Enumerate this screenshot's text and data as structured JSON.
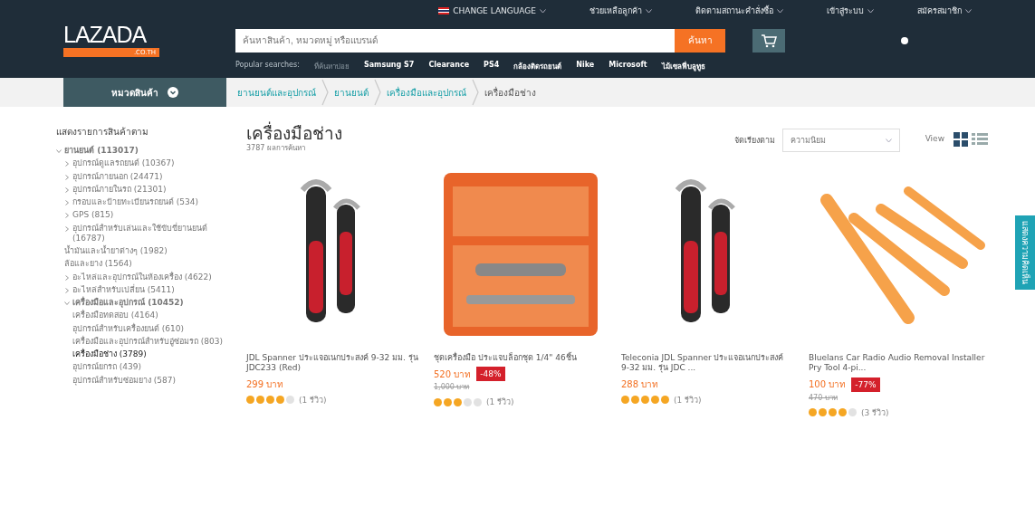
{
  "top_bar": {
    "language": "CHANGE LANGUAGE",
    "links": [
      "ช่วยเหลือลูกค้า",
      "ติดตามสถานะคำสั่งซื้อ",
      "เข้าสู่ระบบ",
      "สมัครสมาชิก"
    ]
  },
  "header": {
    "logo": "LAZADA",
    "logo_domain": ".CO.TH",
    "search": {
      "placeholder": "ค้นหาสินค้า, หมวดหมู่ หรือแบรนด์",
      "button": "ค้นหา"
    },
    "popular_label": "Popular searches:",
    "popular": [
      "ที่ค้นหาบ่อย",
      "Samsung S7",
      "Clearance",
      "PS4",
      "กล้องติดรถยนต์",
      "Nike",
      "Microsoft",
      "ไม้เซลฟี่บลูทูธ"
    ]
  },
  "category_button": "หมวดสินค้า",
  "breadcrumbs": [
    {
      "label": "ยานยนต์และอุปกรณ์",
      "current": false
    },
    {
      "label": "ยานยนต์",
      "current": false
    },
    {
      "label": "เครื่องมือและอุปกรณ์",
      "current": false
    },
    {
      "label": "เครื่องมือช่าง",
      "current": true
    }
  ],
  "sidebar": {
    "title": "แสดงรายการสินค้าตาม",
    "tree": [
      {
        "label": "ยานยนต์ (113017)",
        "expanded": true,
        "selected": false,
        "children": [
          {
            "label": "อุปกรณ์ดูแลรถยนต์ (10367)",
            "expanded": false,
            "selected": false
          },
          {
            "label": "อุปกรณ์ภายนอก (24471)",
            "expanded": false,
            "selected": false
          },
          {
            "label": "อุปกรณ์ภายในรถ (21301)",
            "expanded": false,
            "selected": false
          },
          {
            "label": "กรอบและป้ายทะเบียนรถยนต์ (534)",
            "expanded": false,
            "selected": false
          },
          {
            "label": "GPS (815)",
            "expanded": false,
            "selected": false
          },
          {
            "label": "อุปกรณ์สำหรับเล่นและใช้ขับขี่ยานยนต์ (16787)",
            "expanded": false,
            "selected": false
          },
          {
            "label": "น้ำมันและน้ำยาต่างๆ (1982)",
            "expanded": false,
            "selected": false,
            "leaf": true
          },
          {
            "label": "ล้อและยาง (1564)",
            "expanded": false,
            "selected": false,
            "leaf": true
          },
          {
            "label": "อะไหล่และอุปกรณ์ในห้องเครื่อง (4622)",
            "expanded": false,
            "selected": false
          },
          {
            "label": "อะไหล่สำหรับเปลี่ยน (5411)",
            "expanded": false,
            "selected": false
          },
          {
            "label": "เครื่องมือและอุปกรณ์ (10452)",
            "expanded": true,
            "selected": false,
            "children": [
              {
                "label": "เครื่องมือทดสอบ (4164)",
                "expanded": false,
                "selected": false,
                "leaf": true
              },
              {
                "label": "อุปกรณ์สำหรับเครื่องยนต์ (610)",
                "expanded": false,
                "selected": false,
                "leaf": true
              },
              {
                "label": "เครื่องมือและอุปกรณ์สำหรับอู่ซ่อมรถ (803)",
                "expanded": false,
                "selected": false,
                "leaf": true
              },
              {
                "label": "เครื่องมือช่าง (3789)",
                "expanded": false,
                "selected": true,
                "leaf": true
              },
              {
                "label": "อุปกรณ์ยกรถ (439)",
                "expanded": false,
                "selected": false,
                "leaf": true
              },
              {
                "label": "อุปกรณ์สำหรับซ่อมยาง (587)",
                "expanded": false,
                "selected": false,
                "leaf": true
              }
            ]
          }
        ]
      }
    ]
  },
  "listing": {
    "title": "เครื่องมือช่าง",
    "count": "3787 ผลการค้นหา",
    "sort_label": "จัดเรียงตาม",
    "sort_value": "ความนิยม",
    "view_label": "View",
    "views": [
      {
        "kind": "grid",
        "selected": true
      },
      {
        "kind": "list",
        "selected": false
      }
    ]
  },
  "products": [
    {
      "kind": "wrench",
      "name": "JDL Spanner ประแจอเนกประสงค์ 9-32 มม. รุ่น JDC233 (Red)",
      "price": "299 บาท",
      "stars": 4,
      "reviews": "(1 รีวิว)"
    },
    {
      "kind": "socket-set",
      "name": "ชุดเครื่องมือ ประแจบล็อกชุด 1/4\" 46ชิ้น",
      "price": "520 บาท",
      "discount": "-48%",
      "old_price": "1,000 บาท",
      "stars": 3,
      "reviews": "(1 รีวิว)"
    },
    {
      "kind": "wrench",
      "name": "Teleconia JDL Spanner ประแจอเนกประสงค์ 9-32 มม. รุ่น JDC ...",
      "price": "288 บาท",
      "stars": 5,
      "reviews": "(1 รีวิว)"
    },
    {
      "kind": "pry-tools",
      "name": "Bluelans Car Radio Audio Removal Installer Pry Tool 4-pi...",
      "price": "100 บาท",
      "discount": "-77%",
      "old_price": "470 บาท",
      "stars": 4,
      "reviews": "(3 รีวิว)"
    }
  ],
  "feedback_tab": "แสดงความคิดเห็น"
}
